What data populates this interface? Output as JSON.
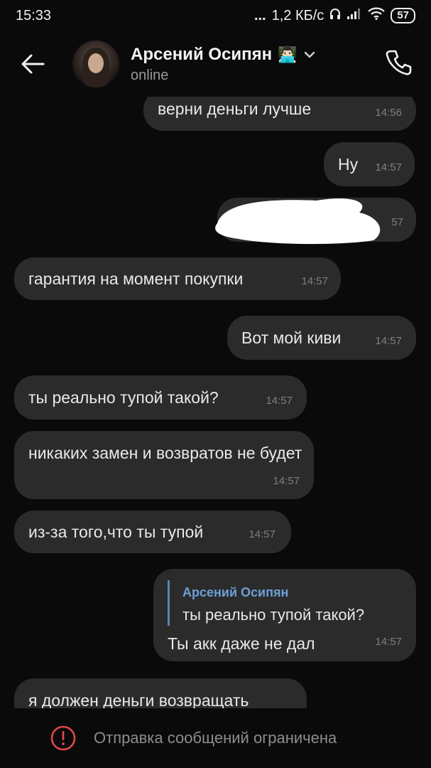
{
  "status_bar": {
    "time": "15:33",
    "dots": "...",
    "speed": "1,2 КБ/с",
    "battery": "57"
  },
  "header": {
    "name": "Арсений Осипян",
    "emoji": "👨🏻‍💻",
    "status": "online"
  },
  "messages": [
    {
      "text": "верни деньги лучше",
      "time": "14:56",
      "side": "right"
    },
    {
      "text": "Ну",
      "time": "14:57",
      "side": "right"
    },
    {
      "text": "",
      "time": "57",
      "side": "right",
      "redacted": true
    },
    {
      "text": "гарантия на момент покупки",
      "time": "14:57",
      "side": "left"
    },
    {
      "text": "Вот мой киви",
      "time": "14:57",
      "side": "right"
    },
    {
      "text": "ты реально тупой такой?",
      "time": "14:57",
      "side": "left"
    },
    {
      "text": "никаких замен и возвратов не будет",
      "time": "14:57",
      "side": "left"
    },
    {
      "text": "из-за того,что ты тупой",
      "time": "14:57",
      "side": "left"
    },
    {
      "reply_name": "Арсений Осипян",
      "reply_text": "ты реально тупой такой?",
      "text": "Ты акк даже не дал",
      "time": "14:57",
      "side": "right"
    },
    {
      "text": "я должен деньги возвращать",
      "time": "",
      "side": "left"
    }
  ],
  "bottom": {
    "message": "Отправка сообщений ограничена"
  },
  "colors": {
    "background": "#0a0a0a",
    "bubble": "#2b2b2b",
    "reply_accent": "#6e9fd6",
    "warning": "#e0474c"
  }
}
